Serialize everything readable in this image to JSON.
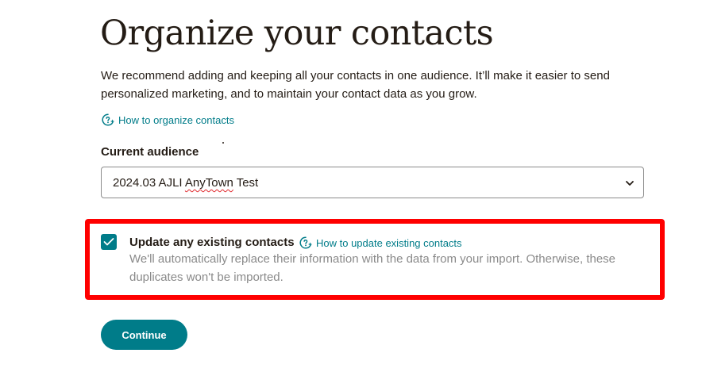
{
  "page": {
    "title": "Organize your contacts",
    "intro": "We recommend adding and keeping all your contacts in one audience. It’ll make it easier to send personalized marketing, and to maintain your contact data as you grow.",
    "organize_link": "How to organize contacts"
  },
  "audience": {
    "label": "Current audience",
    "selected_prefix": "2024.03 AJLI ",
    "selected_flagged": "AnyTown",
    "selected_suffix": " Test"
  },
  "update_option": {
    "checked": true,
    "label": "Update any existing contacts",
    "help_link": "How to update existing contacts",
    "description": "We'll automatically replace their information with the data from your import. Otherwise, these duplicates won't be imported."
  },
  "actions": {
    "continue_label": "Continue"
  },
  "colors": {
    "accent": "#007c89",
    "text": "#241c15",
    "muted": "#8a8a8a",
    "highlight": "#ff0000"
  },
  "icons": {
    "help": "help-sparkle-icon",
    "dropdown": "chevron-down-icon",
    "check": "checkmark-icon"
  }
}
